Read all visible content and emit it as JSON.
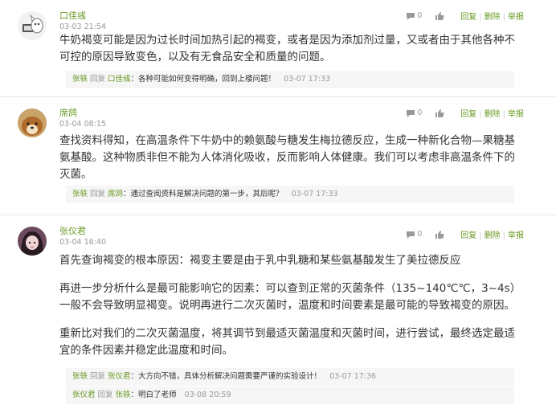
{
  "comments": [
    {
      "author": "口佳彧",
      "time": "03-03 21:54",
      "likes": "0",
      "content": [
        "牛奶褐变可能是因为过长时间加热引起的褐变，或者是因为添加剂过量，又或者由于其他各种不可控的原因导致变色，以及有无食品安全和质量的问题。"
      ],
      "replies": [
        {
          "from": "张轶",
          "verb": "回复",
          "to": "口佳彧",
          "text": "：各种可能如何变得明确，回到上楼问题！",
          "time": "03-07 17:33"
        }
      ]
    },
    {
      "author": "席鸽",
      "time": "03-04 08:15",
      "likes": "0",
      "content": [
        "查找资料得知，在高温条件下牛奶中的赖氨酸与糖发生梅拉德反应，生成一种新化合物—果糖基氨基酸。这种物质非但不能为人体消化吸收，反而影响人体健康。我们可以考虑非高温条件下的灭菌。"
      ],
      "replies": [
        {
          "from": "张轶",
          "verb": "回复",
          "to": "席鸽",
          "text": "：通过查阅资料是解决问题的第一步，其后呢？",
          "time": "03-07 17:33"
        }
      ]
    },
    {
      "author": "张仪君",
      "time": "03-04 16:40",
      "likes": "0",
      "content": [
        "首先查询褐变的根本原因：褐变主要是由于乳中乳糖和某些氨基酸发生了美拉德反应",
        "再进一步分析什么是最可能影响它的因素：可以查到正常的灭菌条件（135~140℃℃，3~4s）一般不会导致明显褐变。说明再进行二次灭菌时，温度和时间要素是最可能的导致褐变的原因。",
        "重新比对我们的二次灭菌温度，将其调节到最适灭菌温度和灭菌时间，进行尝试，最终选定最适宜的条件因素并稳定此温度和时间。"
      ],
      "replies": [
        {
          "from": "张轶",
          "verb": "回复",
          "to": "张仪君",
          "text": "：大方向不错，具体分析解决问题需要严谨的实验设计！",
          "time": "03-07 17:36"
        },
        {
          "from": "张仪君",
          "verb": "回复",
          "to": "张轶",
          "text": "：明白了老师",
          "time": "03-08 20:59"
        }
      ]
    }
  ],
  "labels": {
    "reply": "回复",
    "delete": "删除",
    "report": "举报"
  },
  "colors": {
    "accent": "#6a9a24",
    "muted": "#999999",
    "reply_bg": "#f6f6f6"
  },
  "icons": {
    "comment": "comment-bubble-icon",
    "like": "thumbs-up-icon"
  }
}
